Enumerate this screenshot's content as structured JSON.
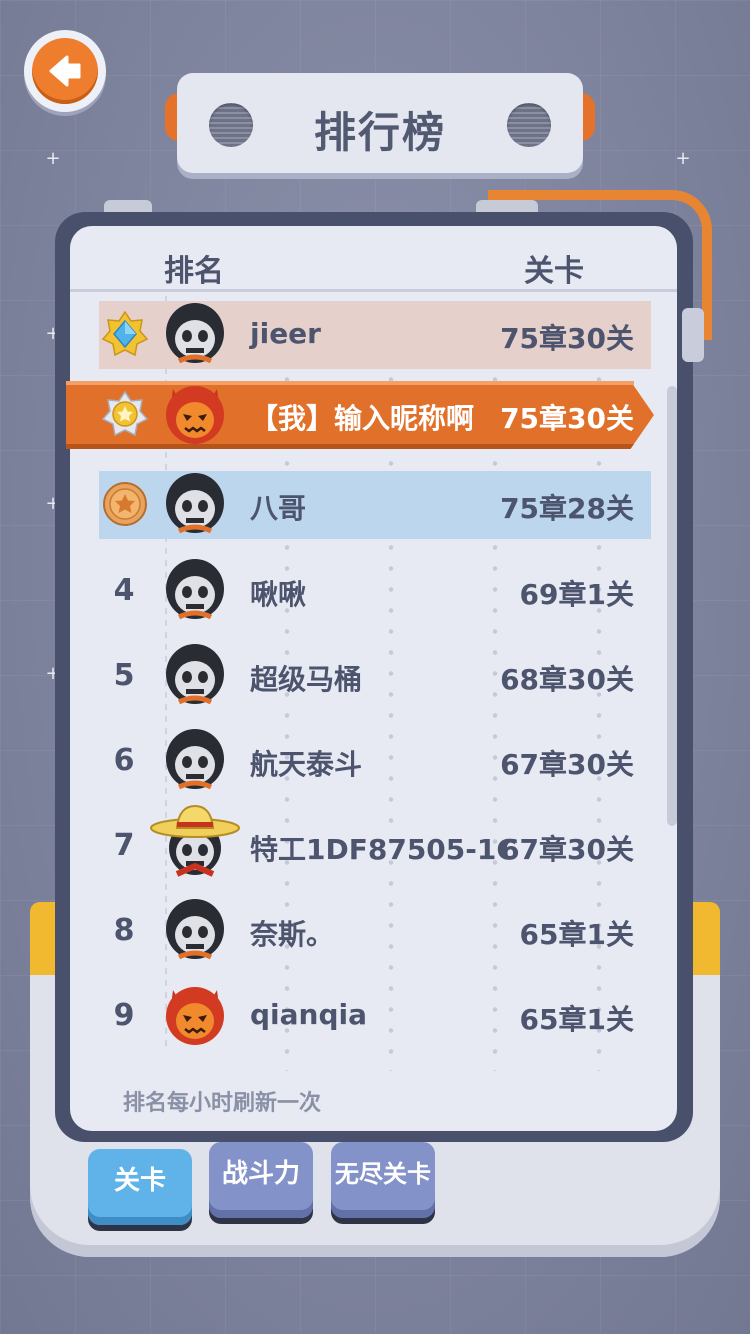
{
  "title": "排行榜",
  "header": {
    "rank_label": "排名",
    "level_label": "关卡"
  },
  "rows": [
    {
      "rank": "1",
      "badge": "diamond-star-badge-icon",
      "name": "jieer",
      "score": "75章30关",
      "avatar": "skull-hood-avatar"
    },
    {
      "rank": "2",
      "badge": "silver-star-badge-icon",
      "name": "【我】输入昵称啊",
      "score": "75章30关",
      "avatar": "devil-hood-avatar",
      "is_me": true
    },
    {
      "rank": "3",
      "badge": "bronze-star-badge-icon",
      "name": "八哥",
      "score": "75章28关",
      "avatar": "skull-hood-avatar"
    },
    {
      "rank": "4",
      "name": "啾啾",
      "score": "69章1关",
      "avatar": "skull-hood-avatar"
    },
    {
      "rank": "5",
      "name": "超级马桶",
      "score": "68章30关",
      "avatar": "skull-hood-avatar"
    },
    {
      "rank": "6",
      "name": "航天泰斗",
      "score": "67章30关",
      "avatar": "skull-hood-avatar"
    },
    {
      "rank": "7",
      "name": "特工1DF87505-1C",
      "score": "67章30关",
      "avatar": "straw-hat-avatar"
    },
    {
      "rank": "8",
      "name": "奈斯。",
      "score": "65章1关",
      "avatar": "skull-hood-avatar"
    },
    {
      "rank": "9",
      "name": "qianqia",
      "score": "65章1关",
      "avatar": "devil-hood-avatar"
    }
  ],
  "refresh_note": "排名每小时刷新一次",
  "tabs": [
    {
      "label": "关卡",
      "active": true
    },
    {
      "label": "战斗力",
      "active": false
    },
    {
      "label": "无尽关卡",
      "active": false
    }
  ],
  "colors": {
    "accent_orange": "#e0702a",
    "rank1_bg": "#e6d0cc",
    "rank3_bg": "#bcd6ee",
    "text": "#4d556e",
    "tab_active": "#5fb3e8",
    "tab_inactive": "#8393c9"
  }
}
